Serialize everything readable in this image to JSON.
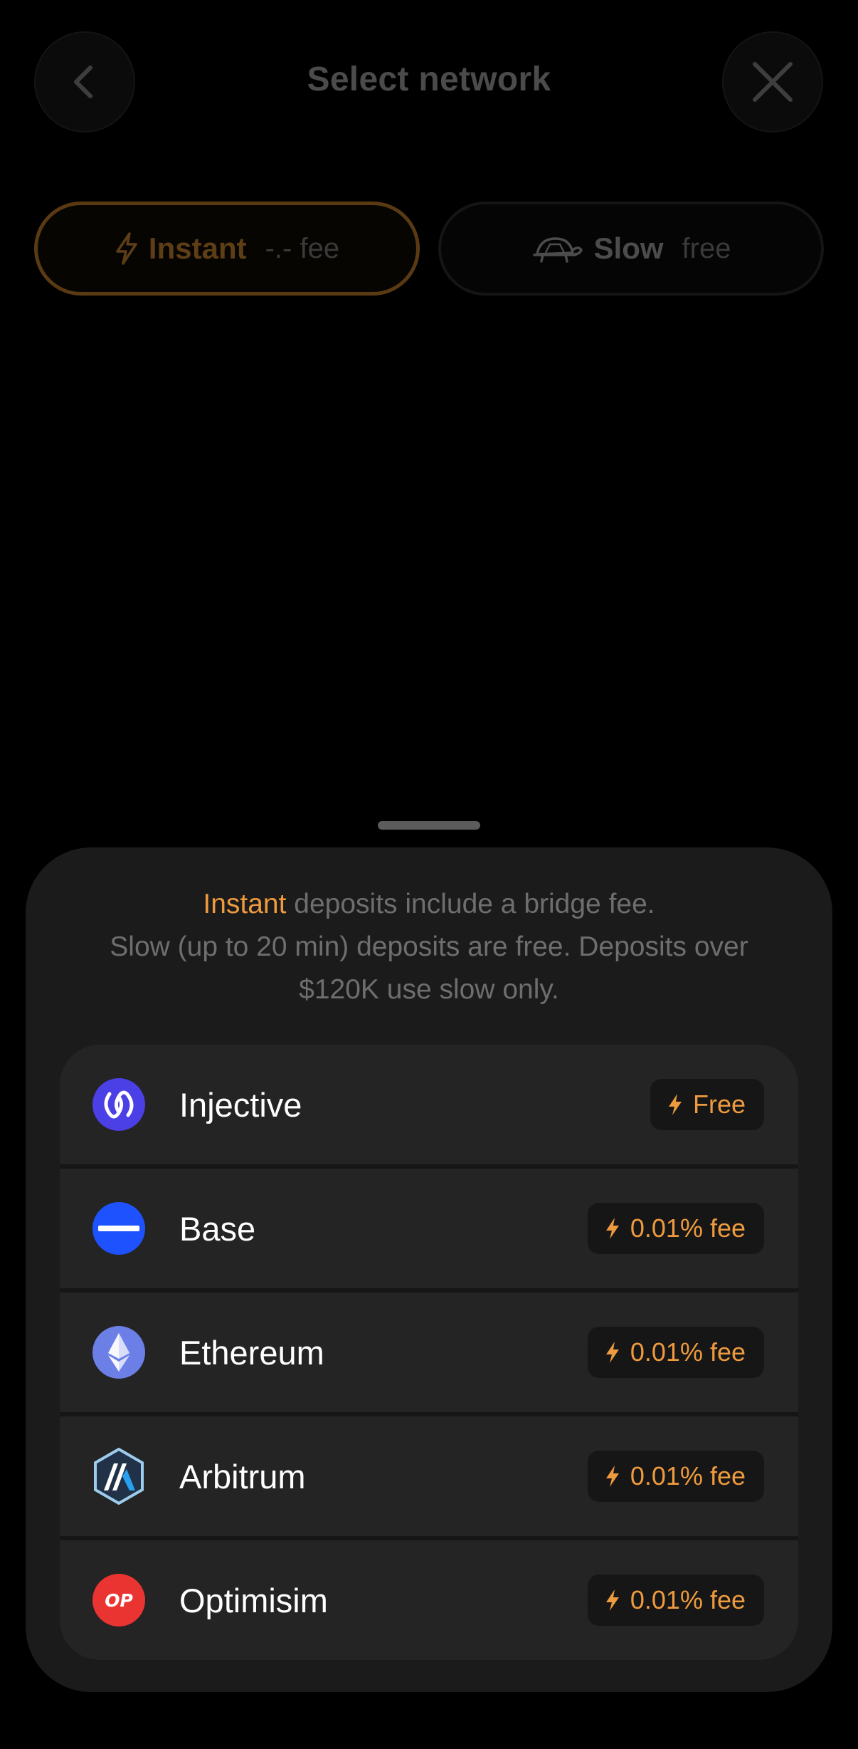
{
  "header": {
    "title": "Select network",
    "back_icon": "chevron-left-icon",
    "close_icon": "close-icon"
  },
  "speed_toggle": {
    "instant": {
      "label": "Instant",
      "fee": "-.- fee",
      "icon": "lightning-icon",
      "selected": true
    },
    "slow": {
      "label": "Slow",
      "fee": "free",
      "icon": "turtle-icon",
      "selected": false
    }
  },
  "sheet": {
    "note_accent": "Instant",
    "note_line1_rest": " deposits include a bridge fee.",
    "note_line2": "Slow (up to 20 min) deposits are free. Deposits over",
    "note_line3": "$120K use slow only.",
    "networks": [
      {
        "name": "Injective",
        "fee": "Free",
        "logo": "injective-logo-icon",
        "color": "#4b3fe6"
      },
      {
        "name": "Base",
        "fee": "0.01% fee",
        "logo": "base-logo-icon",
        "color": "#1f52ff"
      },
      {
        "name": "Ethereum",
        "fee": "0.01% fee",
        "logo": "ethereum-logo-icon",
        "color": "#6c7fe6"
      },
      {
        "name": "Arbitrum",
        "fee": "0.01% fee",
        "logo": "arbitrum-logo-icon",
        "color": "#213147"
      },
      {
        "name": "Optimisim",
        "fee": "0.01% fee",
        "logo": "optimism-logo-icon",
        "color": "#ea3431"
      }
    ]
  },
  "colors": {
    "accent": "#ee9a3e",
    "sheet_background": "#1b1b1b",
    "row_background": "#242424"
  }
}
